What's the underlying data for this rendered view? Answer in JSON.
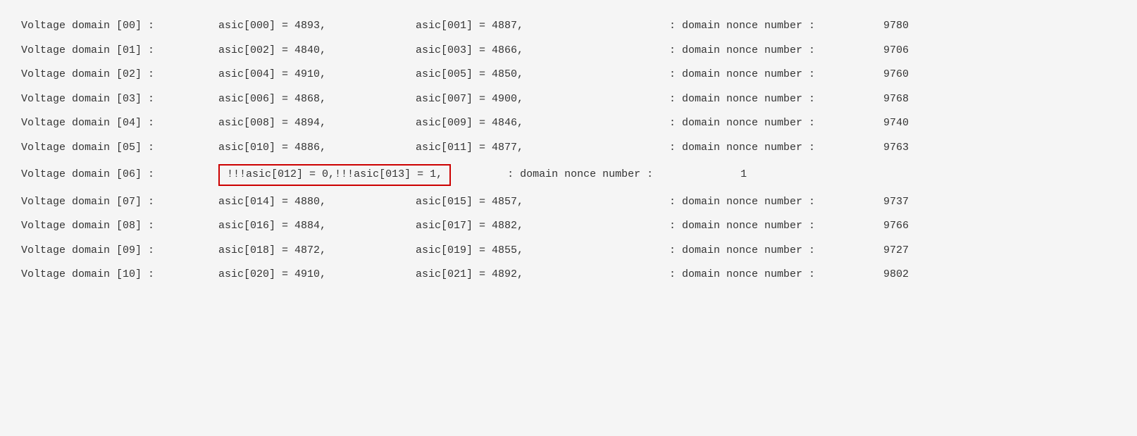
{
  "rows": [
    {
      "domain": "Voltage domain [00] :",
      "asic1_prefix": "",
      "asic1": "asic[000] = 4893,",
      "asic2_prefix": "",
      "asic2": "asic[001] = 4887,",
      "nonce_label": ": domain nonce number :",
      "nonce_value": "9780",
      "highlighted": false
    },
    {
      "domain": "Voltage domain [01] :",
      "asic1_prefix": "",
      "asic1": "asic[002] = 4840,",
      "asic2_prefix": "",
      "asic2": "asic[003] = 4866,",
      "nonce_label": ": domain nonce number :",
      "nonce_value": "9706",
      "highlighted": false
    },
    {
      "domain": "Voltage domain [02] :",
      "asic1_prefix": "",
      "asic1": "asic[004] = 4910,",
      "asic2_prefix": "",
      "asic2": "asic[005] = 4850,",
      "nonce_label": ": domain nonce number :",
      "nonce_value": "9760",
      "highlighted": false
    },
    {
      "domain": "Voltage domain [03] :",
      "asic1_prefix": "",
      "asic1": "asic[006] = 4868,",
      "asic2_prefix": "",
      "asic2": "asic[007] = 4900,",
      "nonce_label": ": domain nonce number :",
      "nonce_value": "9768",
      "highlighted": false
    },
    {
      "domain": "Voltage domain [04] :",
      "asic1_prefix": "",
      "asic1": "asic[008] = 4894,",
      "asic2_prefix": "",
      "asic2": "asic[009] = 4846,",
      "nonce_label": ": domain nonce number :",
      "nonce_value": "9740",
      "highlighted": false
    },
    {
      "domain": "Voltage domain [05] :",
      "asic1_prefix": "",
      "asic1": "asic[010] = 4886,",
      "asic2_prefix": "",
      "asic2": "asic[011] = 4877,",
      "nonce_label": ": domain nonce number :",
      "nonce_value": "9763",
      "highlighted": false
    },
    {
      "domain": "Voltage domain [06] :",
      "asic1_prefix": "!!! ",
      "asic1": "asic[012] =      0,",
      "asic2_prefix": "  !!! ",
      "asic2": "asic[013] =      1,",
      "nonce_label": ": domain nonce number :",
      "nonce_value": "1",
      "highlighted": true
    },
    {
      "domain": "Voltage domain [07] :",
      "asic1_prefix": "",
      "asic1": "asic[014] = 4880,",
      "asic2_prefix": "",
      "asic2": "asic[015] = 4857,",
      "nonce_label": ": domain nonce number :",
      "nonce_value": "9737",
      "highlighted": false
    },
    {
      "domain": "Voltage domain [08] :",
      "asic1_prefix": "",
      "asic1": "asic[016] = 4884,",
      "asic2_prefix": "",
      "asic2": "asic[017] = 4882,",
      "nonce_label": ": domain nonce number :",
      "nonce_value": "9766",
      "highlighted": false
    },
    {
      "domain": "Voltage domain [09] :",
      "asic1_prefix": "",
      "asic1": "asic[018] = 4872,",
      "asic2_prefix": "",
      "asic2": "asic[019] = 4855,",
      "nonce_label": ": domain nonce number :",
      "nonce_value": "9727",
      "highlighted": false
    },
    {
      "domain": "Voltage domain [10] :",
      "asic1_prefix": "",
      "asic1": "asic[020] = 4910,",
      "asic2_prefix": "",
      "asic2": "asic[021] = 4892,",
      "nonce_label": ": domain nonce number :",
      "nonce_value": "9802",
      "highlighted": false
    }
  ]
}
